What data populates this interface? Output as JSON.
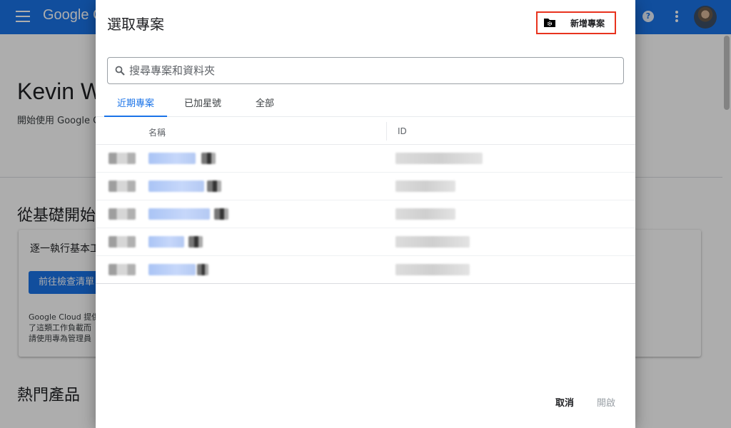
{
  "background": {
    "logo_text": "Google Cloud",
    "greeting_title": "Kevin W",
    "greeting_subtitle": "開始使用 Google Cloud",
    "section_title": "從基礎開始",
    "card_title": "逐一執行基本工作",
    "card_button": "前往檢查清單",
    "card_body": [
      "Google Cloud 提供",
      "了這類工作負載而",
      "請使用專為管理員"
    ],
    "popular_title": "熱門產品"
  },
  "dialog": {
    "title": "選取專案",
    "new_project_label": "新增專案",
    "search_placeholder": "搜尋專案和資料夾",
    "tabs": [
      {
        "label": "近期專案",
        "active": true
      },
      {
        "label": "已加星號",
        "active": false
      },
      {
        "label": "全部",
        "active": false
      }
    ],
    "columns": {
      "name": "名稱",
      "id": "ID"
    },
    "row_count": 5,
    "cancel_label": "取消",
    "open_label": "開啟"
  },
  "colors": {
    "brand_blue": "#1a73e8",
    "highlight_red": "#e8331e"
  },
  "icons": [
    "menu-icon",
    "folder-settings-icon",
    "search-icon",
    "help-icon",
    "more-vert-icon"
  ]
}
